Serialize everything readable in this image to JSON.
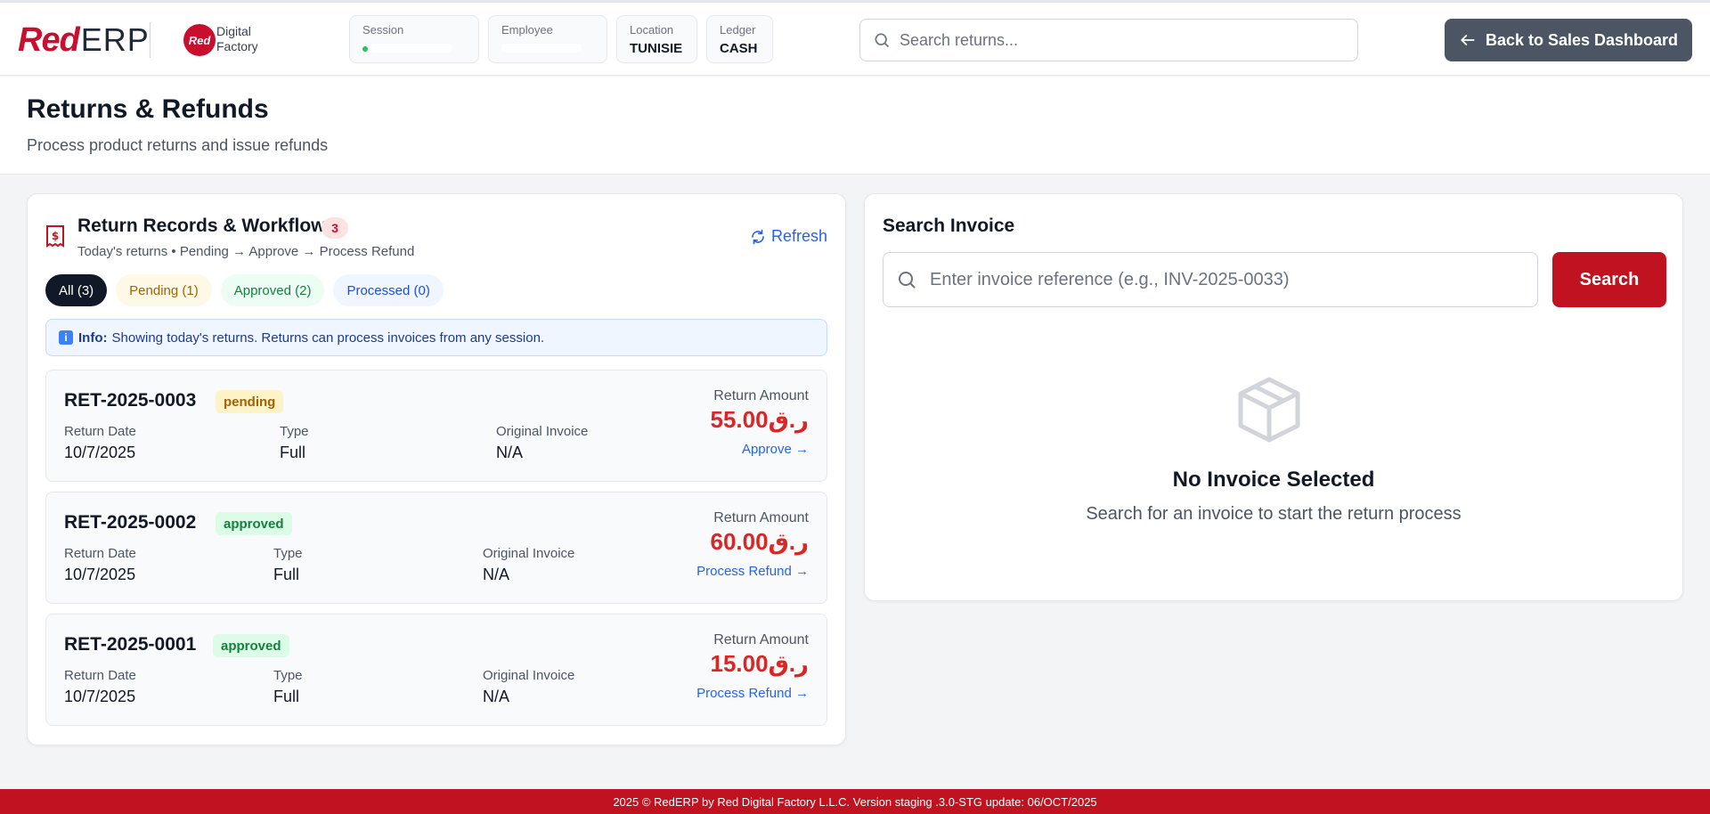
{
  "brand": {
    "logo_red": "Red",
    "logo_erp": "ERP",
    "badge_text": "Red",
    "partner_line1": "Digital",
    "partner_line2": "Factory"
  },
  "header": {
    "session": {
      "label": "Session"
    },
    "employee": {
      "label": "Employee"
    },
    "location": {
      "label": "Location",
      "value": "TUNISIE"
    },
    "ledger": {
      "label": "Ledger",
      "value": "CASH"
    },
    "search_placeholder": "Search returns...",
    "back_button": "Back to Sales Dashboard"
  },
  "page": {
    "title": "Returns & Refunds",
    "subtitle": "Process product returns and issue refunds"
  },
  "records": {
    "title": "Return Records & Workflow",
    "count": "3",
    "subtitle": "Today's returns • Pending → Approve → Process Refund",
    "refresh_label": "Refresh",
    "filters": [
      {
        "label": "All (3)"
      },
      {
        "label": "Pending (1)"
      },
      {
        "label": "Approved (2)"
      },
      {
        "label": "Processed (0)"
      }
    ],
    "info_label": "Info:",
    "info_text": "Showing today's returns. Returns can process invoices from any session.",
    "col_labels": {
      "date": "Return Date",
      "type": "Type",
      "invoice": "Original Invoice",
      "amount": "Return Amount"
    },
    "items": [
      {
        "id": "RET-2025-0003",
        "status": "pending",
        "date": "10/7/2025",
        "type": "Full",
        "invoice": "N/A",
        "amount": "55.00ر.ق",
        "action": "Approve →"
      },
      {
        "id": "RET-2025-0002",
        "status": "approved",
        "date": "10/7/2025",
        "type": "Full",
        "invoice": "N/A",
        "amount": "60.00ر.ق",
        "action": "Process Refund →"
      },
      {
        "id": "RET-2025-0001",
        "status": "approved",
        "date": "10/7/2025",
        "type": "Full",
        "invoice": "N/A",
        "amount": "15.00ر.ق",
        "action": "Process Refund →"
      }
    ]
  },
  "search_invoice": {
    "title": "Search Invoice",
    "placeholder": "Enter invoice reference (e.g., INV-2025-0033)",
    "button": "Search",
    "empty_title": "No Invoice Selected",
    "empty_subtitle": "Search for an invoice to start the return process"
  },
  "footer": {
    "text": "2025 © RedERP by Red Digital Factory L.L.C. Version staging .3.0-STG update: 06/OCT/2025"
  },
  "colors": {
    "brand_red": "#c1121f",
    "amount_red": "#dc2626",
    "link_blue": "#2563eb",
    "dark_button": "#4b5563"
  }
}
